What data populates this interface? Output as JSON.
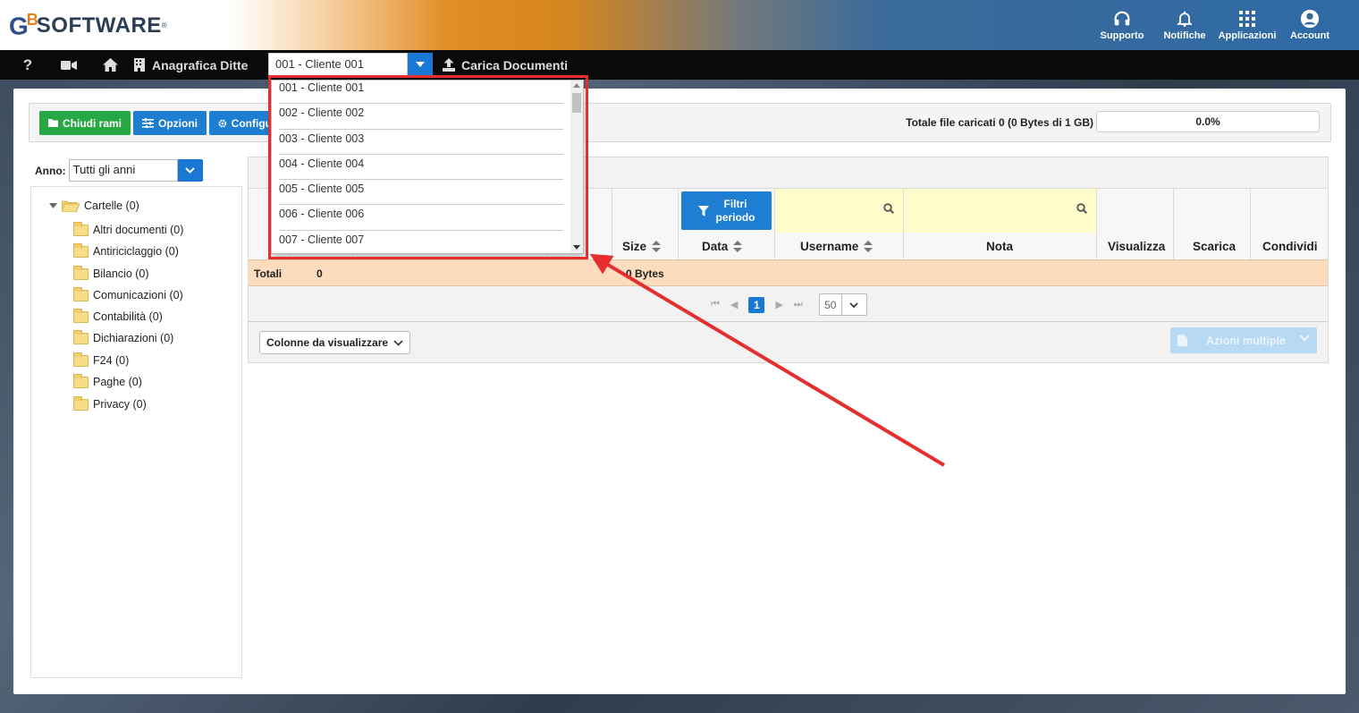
{
  "header": {
    "logo_text": "SOFTWARE",
    "logo_mark": "G",
    "logo_b": "B",
    "logo_reg": "®",
    "nav": [
      {
        "label": "Supporto",
        "icon": "headset-icon"
      },
      {
        "label": "Notifiche",
        "icon": "bell-icon"
      },
      {
        "label": "Applicazioni",
        "icon": "grid-icon"
      },
      {
        "label": "Account",
        "icon": "user-circle-icon"
      }
    ]
  },
  "menubar": {
    "help_icon_text": "?",
    "anagrafica_label": "Anagrafica Ditte",
    "ditta_selected": "001 - Cliente 001",
    "carica_label": "Carica Documenti"
  },
  "toolbar": {
    "chiudi_label": "Chiudi rami",
    "opzioni_label": "Opzioni",
    "config_label": "Configu",
    "totale_label": "Totale file caricati 0 (0 Bytes di 1 GB)",
    "progress_value": "0.0%"
  },
  "anno": {
    "label": "Anno:",
    "value": "Tutti gli anni"
  },
  "tree": {
    "root": "Cartelle (0)",
    "items": [
      "Altri documenti (0)",
      "Antiriciclaggio (0)",
      "Bilancio (0)",
      "Comunicazioni (0)",
      "Contabilità (0)",
      "Dichiarazioni (0)",
      "F24 (0)",
      "Paghe (0)",
      "Privacy (0)"
    ]
  },
  "grid": {
    "filtri_label_1": "Filtri",
    "filtri_label_2": "periodo",
    "headers": {
      "size": "Size",
      "data": "Data",
      "username": "Username",
      "nota": "Nota",
      "visualizza": "Visualizza",
      "scarica": "Scarica",
      "condividi": "Condividi"
    },
    "totals": {
      "label": "Totali",
      "count": "0",
      "size": "0 Bytes"
    },
    "pager": {
      "current_page": "1",
      "page_size": "50"
    },
    "colonne_label": "Colonne da visualizzare",
    "azioni_label": "Azioni multiple"
  },
  "dropdown": {
    "options": [
      "001 - Cliente 001",
      "002 - Cliente 002",
      "003 - Cliente 003",
      "004 - Cliente 004",
      "005 - Cliente 005",
      "006 - Cliente 006",
      "007 - Cliente 007"
    ]
  },
  "colors": {
    "accent_blue": "#1878d4",
    "green": "#28a745",
    "highlight_red": "#e52e2e",
    "totals_row": "#fddcbd",
    "filter_yellow": "#fffdcc"
  }
}
